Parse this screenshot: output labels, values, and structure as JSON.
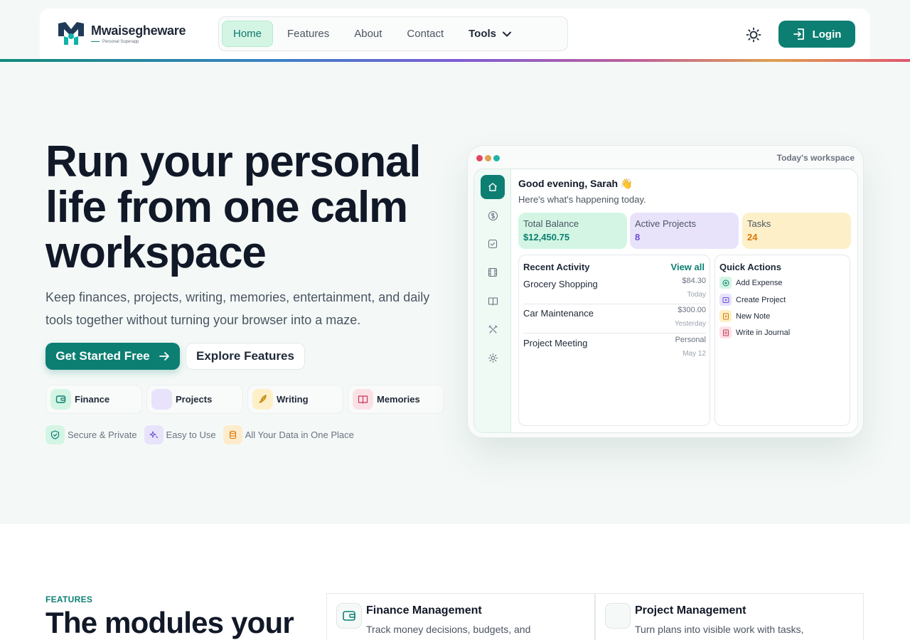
{
  "brand": {
    "name": "Mwaisegheware",
    "tagline": "Personal Superapp"
  },
  "nav": {
    "items": [
      {
        "label": "Home",
        "active": true
      },
      {
        "label": "Features"
      },
      {
        "label": "About"
      },
      {
        "label": "Contact"
      }
    ],
    "tools_label": "Tools"
  },
  "header": {
    "login_label": "Login",
    "theme_icon": "sun-icon"
  },
  "hero": {
    "title": "Run your personal life from one calm workspace",
    "subtitle": "Keep finances, projects, writing, memories, entertainment, and daily tools together without turning your browser into a maze.",
    "cta_primary": "Get Started Free",
    "cta_secondary": "Explore Features",
    "modules": [
      "Finance",
      "Projects",
      "Writing",
      "Memories"
    ],
    "badges": [
      "Secure & Private",
      "Easy to Use",
      "All Your Data in One Place"
    ]
  },
  "preview": {
    "title": "Today's workspace",
    "greeting": "Good evening, Sarah 👋",
    "greeting_sub": "Here's what's happening today.",
    "stats": [
      {
        "label": "Total Balance",
        "value": "$12,450.75",
        "color": "#0c7f72"
      },
      {
        "label": "Active Projects",
        "value": "8",
        "color": "#6d4fd0"
      },
      {
        "label": "Tasks",
        "value": "24",
        "color": "#d97706"
      }
    ],
    "recent": {
      "title": "Recent Activity",
      "view_all": "View all",
      "items": [
        {
          "name": "Grocery Shopping",
          "amount": "$84.30",
          "date": "Today"
        },
        {
          "name": "Car Maintenance",
          "amount": "$300.00",
          "date": "Yesterday"
        },
        {
          "name": "Project Meeting",
          "amount": "Personal",
          "date": "May 12"
        }
      ]
    },
    "quick": {
      "title": "Quick Actions",
      "items": [
        "Add Expense",
        "Create Project",
        "New Note",
        "Write in Journal"
      ]
    }
  },
  "features": {
    "eyebrow": "FEATURES",
    "heading": "The modules your",
    "cards": [
      {
        "title": "Finance Management",
        "desc": "Track money decisions, budgets, and"
      },
      {
        "title": "Project Management",
        "desc": "Turn plans into visible work with tasks,"
      }
    ]
  },
  "colors": {
    "accent": "#0c7f72",
    "background": "#f4f9f7"
  }
}
